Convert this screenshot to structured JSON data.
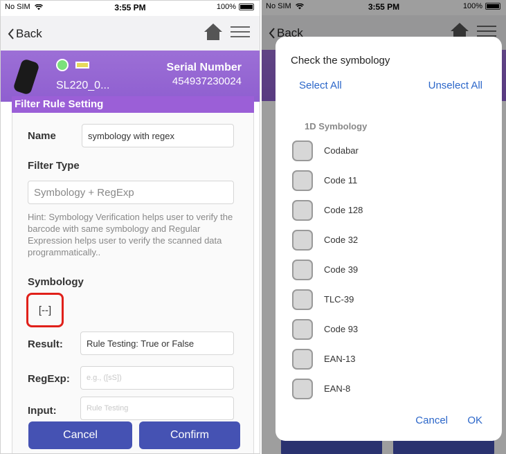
{
  "status_bar": {
    "carrier": "No SIM",
    "time": "3:55 PM",
    "battery": "100%"
  },
  "nav": {
    "back_label": "Back"
  },
  "device": {
    "name": "SL220_0...",
    "serial_label": "Serial Number",
    "serial_value": "454937230024"
  },
  "form": {
    "section_title": "Filter Rule Setting",
    "name_label": "Name",
    "name_value": "symbology with regex",
    "filter_type_label": "Filter Type",
    "filter_type_value": "Symbology + RegExp",
    "hint": "Hint: Symbology Verification helps user to verify the barcode with same symbology and Regular Expression helps user to  verify the scanned data programmatically..",
    "symbology_label": "Symbology",
    "symbology_value": "[--]",
    "result_label": "Result:",
    "result_value": "Rule Testing: True or False",
    "regexp_label": "RegExp:",
    "regexp_placeholder": "e.g., ([sS])",
    "input_label": "Input:",
    "input_placeholder": "Rule Testing",
    "cancel_label": "Cancel",
    "confirm_label": "Confirm"
  },
  "right_status_bar": {
    "carrier": "No SIM",
    "time": "3:55 PM",
    "battery": "100%"
  },
  "right_nav": {
    "back_label": "Back"
  },
  "dialog": {
    "title": "Check the symbology",
    "select_all": "Select All",
    "unselect_all": "Unselect All",
    "group_label": "1D Symbology",
    "items": [
      {
        "label": "Codabar",
        "checked": false
      },
      {
        "label": "Code 11",
        "checked": false
      },
      {
        "label": "Code 128",
        "checked": false
      },
      {
        "label": "Code 32",
        "checked": false
      },
      {
        "label": "Code 39",
        "checked": false
      },
      {
        "label": "TLC-39",
        "checked": false
      },
      {
        "label": "Code 93",
        "checked": false
      },
      {
        "label": "EAN-13",
        "checked": false
      },
      {
        "label": "EAN-8",
        "checked": false
      }
    ],
    "cancel_label": "Cancel",
    "ok_label": "OK"
  },
  "colors": {
    "accent": "#4552b3",
    "header_purple": "#9b5fd7",
    "link_blue": "#2b66c9",
    "highlight_red": "#e0201a"
  },
  "icons": [
    "wifi-icon",
    "battery-icon",
    "back-chevron-icon",
    "home-icon",
    "menu-icon",
    "scanner-icon",
    "status-led-icon",
    "battery-indicator-icon"
  ]
}
